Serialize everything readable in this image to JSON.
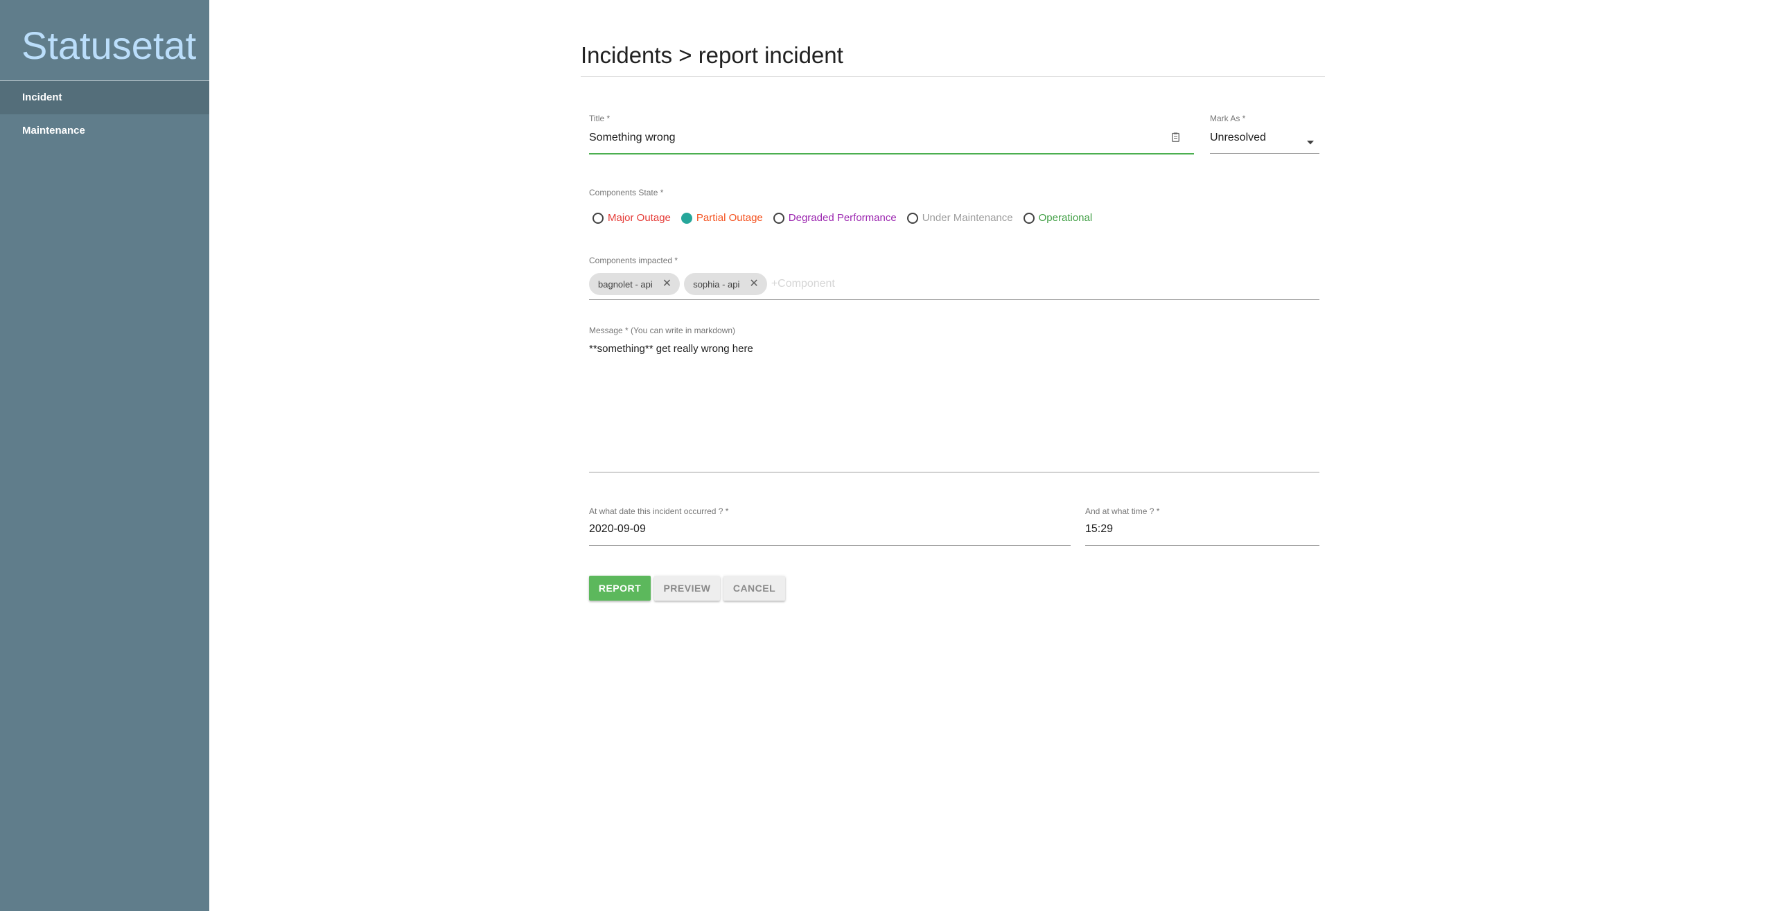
{
  "app": {
    "brand": "Statusetat"
  },
  "sidebar": {
    "items": [
      {
        "label": "Incident",
        "active": true
      },
      {
        "label": "Maintenance",
        "active": false
      }
    ]
  },
  "page": {
    "title": "Incidents > report incident"
  },
  "form": {
    "title_label": "Title *",
    "title_value": "Something wrong",
    "mark_as_label": "Mark As *",
    "mark_as_value": "Unresolved",
    "components_state_label": "Components State *",
    "states": [
      {
        "label": "Major Outage",
        "color": "#e53935",
        "checked": false
      },
      {
        "label": "Partial Outage",
        "color": "#f4511e",
        "checked": true
      },
      {
        "label": "Degraded Performance",
        "color": "#9c27b0",
        "checked": false
      },
      {
        "label": "Under Maintenance",
        "color": "#9e9e9e",
        "checked": false
      },
      {
        "label": "Operational",
        "color": "#43a047",
        "checked": false
      }
    ],
    "components_impacted_label": "Components impacted *",
    "components": [
      "bagnolet - api",
      "sophia - api"
    ],
    "component_placeholder": "+Component",
    "message_label": "Message * (You can write in markdown)",
    "message_value": "**something** get really wrong here",
    "date_label": "At what date this incident occurred ? *",
    "date_value": "2020-09-09",
    "time_label": "And at what time ? *",
    "time_value": "15:29"
  },
  "actions": {
    "report_label": "REPORT",
    "preview_label": "PREVIEW",
    "cancel_label": "CANCEL"
  },
  "colors": {
    "sidebar_bg": "#607d8b",
    "brand_text": "#bbdefb",
    "accent_green": "#5cb85c",
    "radio_checked": "#26a69a"
  }
}
